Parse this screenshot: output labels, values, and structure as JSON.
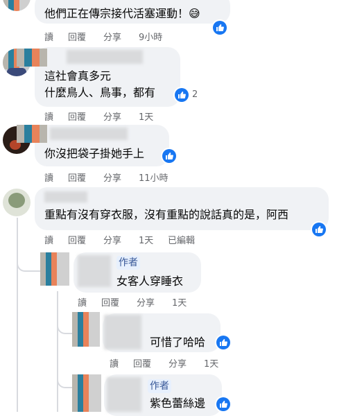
{
  "comments": [
    {
      "id": "c0",
      "lines": [
        "他們正在傳宗接代活塞運動！😅"
      ],
      "actions": {
        "read": "讀",
        "reply": "回覆",
        "share": "分享",
        "time": "9小時"
      },
      "reaction_icon": "like-icon"
    },
    {
      "id": "c1",
      "lines": [
        "這社會真多元",
        "什麼鳥人、鳥事，都有"
      ],
      "reaction_count": "2",
      "actions": {
        "read": "讀",
        "reply": "回覆",
        "share": "分享",
        "time": "1天"
      },
      "reaction_icon": "like-icon"
    },
    {
      "id": "c2",
      "lines": [
        "你沒把袋子掛她手上"
      ],
      "actions": {
        "read": "讀",
        "reply": "回覆",
        "share": "分享",
        "time": "11小時"
      },
      "reaction_icon": "like-icon"
    },
    {
      "id": "c3",
      "lines": [
        "重點有沒有穿衣服，沒有重點的說話真的是，阿西"
      ],
      "actions": {
        "read": "讀",
        "reply": "回覆",
        "share": "分享",
        "time": "1天",
        "edited": "已編輯"
      },
      "reaction_icon": "like-icon"
    }
  ],
  "replies": [
    {
      "id": "r1",
      "author_badge": "作者",
      "lines": [
        "女客人穿睡衣"
      ],
      "actions": {
        "read": "讀",
        "reply": "回覆",
        "share": "分享",
        "time": "1天"
      }
    },
    {
      "id": "r2",
      "lines": [
        "可惜了哈哈"
      ],
      "actions": {
        "read": "讀",
        "reply": "回覆",
        "share": "分享",
        "time": "1天"
      },
      "reaction_icon": "like-icon"
    },
    {
      "id": "r3",
      "author_badge": "作者",
      "lines": [
        "紫色蕾絲邊"
      ],
      "reaction_icon": "like-icon"
    }
  ],
  "colors": {
    "bubble": "#f0f2f5",
    "like": "#1877f2",
    "meta": "#65676b",
    "stripe_teal": "#2a7f9e",
    "stripe_orange": "#e8835a",
    "stripe_gray": "#b8b5ad"
  }
}
